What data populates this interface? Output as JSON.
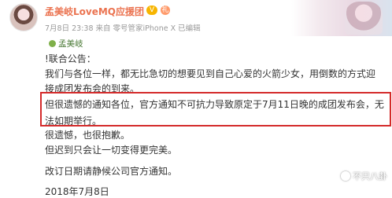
{
  "post": {
    "author": "孟美岐LoveMQ应援团",
    "badge_vip": "V",
    "badge_gift": "礼",
    "meta": "7月8日 23:38 来自 零号管家iPhone X  已编辑",
    "repost_author": "孟美岐"
  },
  "body": {
    "line1": "!联合公告：",
    "line2": "我们与各位一样，都无比急切的想要见到自己心爱的火箭少女，用倒数的方式迎",
    "line3": "接成团发布会的到来。",
    "line4": "但很遗憾的通知各位，官方通知不可抗力导致原定于7月11日晚的成团发布会，无",
    "line5": "法如期举行。",
    "line6": "很遗憾，也很抱歉。",
    "line7": "但迟到只会让一切变得更完美。",
    "line8": "改订日期请静候公司官方通知。",
    "line9": "2018年7月8日"
  },
  "watermark": {
    "text": "不只八卦"
  },
  "colors": {
    "author": "#eb7350",
    "highlight_border": "#d42a2a",
    "repost_author": "#4a7a36"
  }
}
